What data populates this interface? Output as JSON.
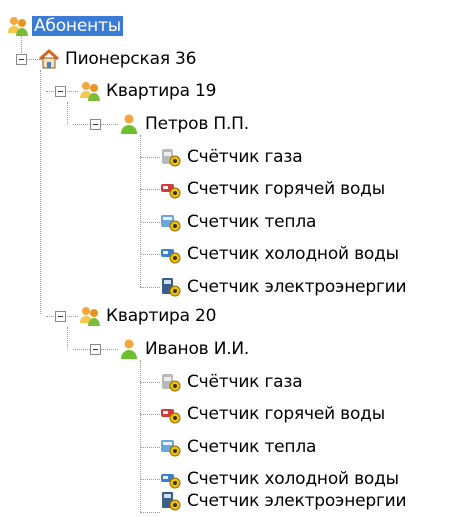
{
  "tree": {
    "root": {
      "label": "Абоненты",
      "icon": "group-icon",
      "selected": true
    },
    "house": {
      "label": "Пионерская 36",
      "icon": "house-icon"
    },
    "apartments": [
      {
        "label": "Квартира 19",
        "icon": "group-icon",
        "subscriber": {
          "label": "Петров П.П.",
          "icon": "person-icon",
          "meters": [
            {
              "label": "Счётчик газа",
              "icon": "gas-meter-icon"
            },
            {
              "label": "Счетчик горячей воды",
              "icon": "hot-water-meter-icon"
            },
            {
              "label": "Счетчик тепла",
              "icon": "heat-meter-icon"
            },
            {
              "label": "Счетчик холодной воды",
              "icon": "cold-water-meter-icon"
            },
            {
              "label": "Счетчик электроэнергии",
              "icon": "electricity-meter-icon"
            }
          ]
        }
      },
      {
        "label": "Квартира 20",
        "icon": "group-icon",
        "subscriber": {
          "label": "Иванов И.И.",
          "icon": "person-icon",
          "meters": [
            {
              "label": "Счётчик газа",
              "icon": "gas-meter-icon"
            },
            {
              "label": "Счетчик горячей воды",
              "icon": "hot-water-meter-icon"
            },
            {
              "label": "Счетчик тепла",
              "icon": "heat-meter-icon"
            },
            {
              "label": "Счетчик холодной воды",
              "icon": "cold-water-meter-icon"
            },
            {
              "label": "Счетчик электроэнергии",
              "icon": "electricity-meter-icon"
            }
          ]
        }
      }
    ]
  },
  "colors": {
    "selection": "#3a7bd5",
    "connector": "#9a9a9a"
  }
}
